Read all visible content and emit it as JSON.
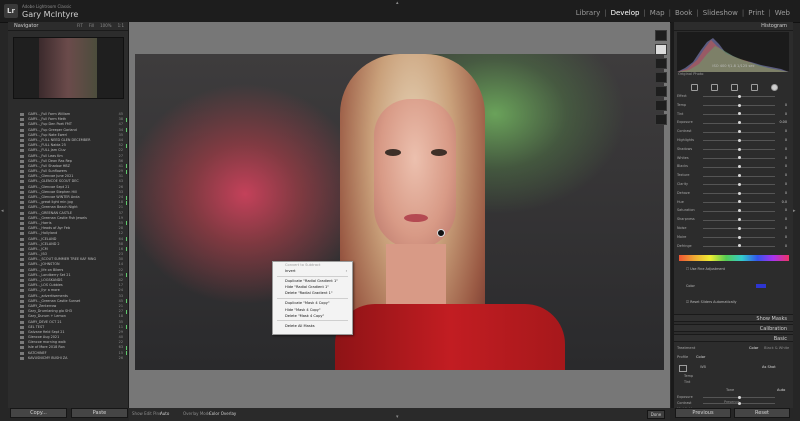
{
  "app": {
    "logo_text": "Lr",
    "subtitle": "Adobe Lightroom Classic",
    "user_name": "Gary McIntyre",
    "modules": [
      "Library",
      "Develop",
      "Map",
      "Book",
      "Slideshow",
      "Print",
      "Web"
    ],
    "active_module": "Develop"
  },
  "left_panel": {
    "navigator_title": "Navigator",
    "zoom_options": [
      "FIT",
      "Fill",
      "100%",
      "1:1"
    ],
    "collections": [
      {
        "name": "GARY..._Full Farm William",
        "count": "45"
      },
      {
        "name": "GARY..._Full Farm Meth",
        "count": "38"
      },
      {
        "name": "GARY..._Fup Den Poet FMT",
        "count": "47"
      },
      {
        "name": "GARY..._Fup Greeper Garland",
        "count": "34"
      },
      {
        "name": "GARY..._Fup Nate Ewerl",
        "count": "35"
      },
      {
        "name": "GARY..._FULL NEED GLEN DECEMBER",
        "count": "44"
      },
      {
        "name": "GARY..._FULL Naida 25 ",
        "count": "52"
      },
      {
        "name": "GARY..._FULL Jam Cluv",
        "count": "22"
      },
      {
        "name": "GARY..._Full Leas Km",
        "count": "27"
      },
      {
        "name": "GARY..._Full Dean Ras Rep",
        "count": "36"
      },
      {
        "name": "GARY..._Full Shadow HBZ",
        "count": "41"
      },
      {
        "name": "GARY..._Full Sunflowers",
        "count": "29"
      },
      {
        "name": "GARY..._Glencoe June 2021",
        "count": "31"
      },
      {
        "name": "GARY..._GLENCOE SCOUT DEC",
        "count": "43"
      },
      {
        "name": "GARY..._Glencoe Sept 21",
        "count": "26"
      },
      {
        "name": "GARY..._Glencoe Stephen Hill",
        "count": "33"
      },
      {
        "name": "GARY..._Glencoe WINTER Anda",
        "count": "24"
      },
      {
        "name": "GARY..._great light min jpg",
        "count": "18"
      },
      {
        "name": "GARY..._Greenan Beach Night",
        "count": "21"
      },
      {
        "name": "GARY..._GREENAN CASTLE",
        "count": "37"
      },
      {
        "name": "GARY..._Greenan Castle Fish Jewels",
        "count": "19"
      },
      {
        "name": "GARY..._Harris",
        "count": "55"
      },
      {
        "name": "GARY..._Heads of Ayr Feb",
        "count": "28"
      },
      {
        "name": "GARY..._Hollyland",
        "count": "12"
      },
      {
        "name": "GARY..._ICELAND",
        "count": "64"
      },
      {
        "name": "GARY..._ICELAND 2",
        "count": "58"
      },
      {
        "name": "GARY..._ICM",
        "count": "16"
      },
      {
        "name": "GARY..._ISO",
        "count": "23"
      },
      {
        "name": "GARY..._SCOUT SUMMER TREE KAF RING",
        "count": "30"
      },
      {
        "name": "GARY..._JOHNSTON",
        "count": "14"
      },
      {
        "name": "GARY..._life on Bikers",
        "count": "22"
      },
      {
        "name": "GARY..._Londberry Set 21",
        "count": "39"
      },
      {
        "name": "GARY..._LOGSKANDS",
        "count": "42"
      },
      {
        "name": "GARY..._LOS Cubbies",
        "count": "17"
      },
      {
        "name": "GARY..._llyr a more",
        "count": "24"
      },
      {
        "name": "GARY..._advertisements",
        "count": "33"
      },
      {
        "name": "GARY..._Greenan Castle Sunset",
        "count": "45"
      },
      {
        "name": "GARY_Zenterrow",
        "count": "21"
      },
      {
        "name": "Gary_Drumlaning glo SH3",
        "count": "27"
      },
      {
        "name": "Gary_Durum + Lemon",
        "count": "18"
      },
      {
        "name": "GARY_DEVE OCT 21",
        "count": "35"
      },
      {
        "name": "GEL TEST",
        "count": "11"
      },
      {
        "name": "Galvane field Sept 21",
        "count": "29"
      },
      {
        "name": "Glencoe Aug 2021",
        "count": "40"
      },
      {
        "name": "Glencoe morning walk",
        "count": "22"
      },
      {
        "name": "Isle of More 2018 Ron",
        "count": "63"
      },
      {
        "name": "KATCHINEF",
        "count": "15"
      },
      {
        "name": "KAVUSNICMY BUSHI ZA",
        "count": "26"
      }
    ],
    "copy_label": "Copy...",
    "paste_label": "Paste"
  },
  "context_menu": {
    "items": [
      {
        "label": "Convert to Subtract",
        "disabled": true
      },
      {
        "label": "Invert",
        "disabled": false,
        "submenu": true
      },
      {
        "sep": true
      },
      {
        "label": "Duplicate \"Radial Gradient 1\"",
        "disabled": false
      },
      {
        "label": "Hide \"Radial Gradient 1\"",
        "disabled": false
      },
      {
        "label": "Delete \"Radial Gradient 1\"",
        "disabled": false
      },
      {
        "sep": true
      },
      {
        "label": "Duplicate \"Mask 4 Copy\"",
        "disabled": false
      },
      {
        "label": "Hide \"Mask 4 Copy\"",
        "disabled": false
      },
      {
        "label": "Delete \"Mask 4 Copy\"",
        "disabled": false
      },
      {
        "sep": true
      },
      {
        "label": "Delete All Masks",
        "disabled": false
      }
    ]
  },
  "toolbar": {
    "show_edit_pins_label": "Show Edit Pins :",
    "show_edit_pins_value": "Auto",
    "overlay_mode_label": "Overlay Mode :",
    "overlay_mode_value": "Color Overlay",
    "done_label": "Done"
  },
  "right_panel": {
    "histogram_title": "Histogram",
    "histogram_values": "ISO 400    f/1.8    1/125 sec",
    "original_photo_label": "Original Photo",
    "sliders": [
      {
        "label": "Effect",
        "value": "",
        "pos": 0.5
      },
      {
        "label": "Temp",
        "value": "0",
        "pos": 0.5
      },
      {
        "label": "Tint",
        "value": "0",
        "pos": 0.5
      },
      {
        "label": "Exposure",
        "value": "0.00",
        "pos": 0.5
      },
      {
        "label": "Contrast",
        "value": "0",
        "pos": 0.5
      },
      {
        "label": "Highlights",
        "value": "0",
        "pos": 0.5
      },
      {
        "label": "Shadows",
        "value": "0",
        "pos": 0.5
      },
      {
        "label": "Whites",
        "value": "0",
        "pos": 0.5
      },
      {
        "label": "Blacks",
        "value": "0",
        "pos": 0.5
      },
      {
        "label": "Texture",
        "value": "0",
        "pos": 0.5
      },
      {
        "label": "Clarity",
        "value": "0",
        "pos": 0.5
      },
      {
        "label": "Dehaze",
        "value": "0",
        "pos": 0.5
      },
      {
        "label": "Hue",
        "value": "0.0",
        "pos": 0.5
      },
      {
        "label": "Saturation",
        "value": "0",
        "pos": 0.5
      },
      {
        "label": "Sharpness",
        "value": "0",
        "pos": 0.5
      },
      {
        "label": "Noise",
        "value": "0",
        "pos": 0.5
      },
      {
        "label": "Moire",
        "value": "0",
        "pos": 0.5
      },
      {
        "label": "Defringe",
        "value": "0",
        "pos": 0.5
      }
    ],
    "use_fine_adjustment_label": "Use Fine Adjustment",
    "color_label": "Color",
    "reset_sliders_label": "Reset Sliders Automatically",
    "show_masks_label": "Show Masks",
    "calibration_title": "Calibration",
    "basic_title": "Basic",
    "treatment_label": "Treatment",
    "treatment_options": [
      "Color",
      "Black & White"
    ],
    "profile_label": "Profile",
    "profile_value": "Color",
    "wb_label": "WB",
    "wb_value": "As Shot",
    "temp_label": "Temp",
    "tint_label": "Tint",
    "tone_label": "Tone",
    "auto_label": "Auto",
    "basic_sliders": [
      "Exposure",
      "Contrast",
      "Highlights",
      "Shadows",
      "Whites",
      "Blacks"
    ],
    "presence_label": "Presence",
    "previous_label": "Previous",
    "reset_label": "Reset"
  },
  "colors": {
    "accent_green": "#5ec86b",
    "panel_bg": "#2c2c2c"
  }
}
